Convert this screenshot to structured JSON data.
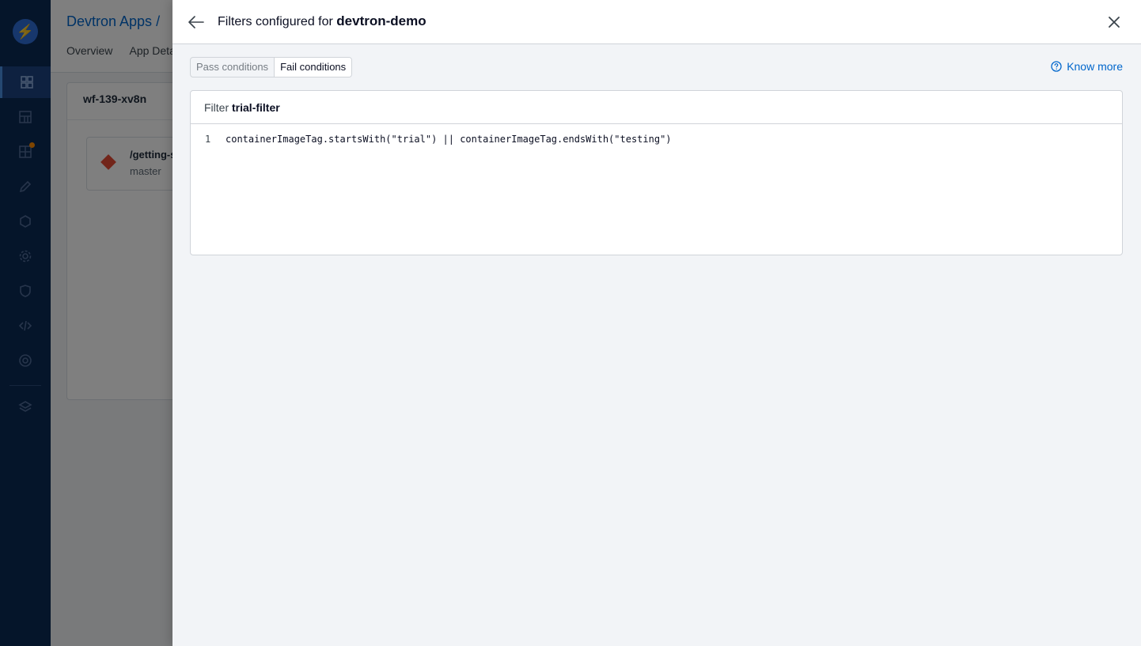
{
  "background": {
    "breadcrumb_title": "Devtron Apps /",
    "tabs": [
      "Overview",
      "App Details"
    ],
    "workflow_name": "wf-139-xv8n",
    "node_path": "/getting-started",
    "node_branch": "master"
  },
  "drawer": {
    "title_prefix": "Filters configured for",
    "app_name": "devtron-demo",
    "tabs": [
      {
        "label": "Pass conditions",
        "selected": false
      },
      {
        "label": "Fail conditions",
        "selected": true
      }
    ],
    "know_more_label": "Know more",
    "filter": {
      "prefix": "Filter",
      "name": "trial-filter",
      "lines": [
        {
          "number": "1",
          "code": "containerImageTag.startsWith(\"trial\") || containerImageTag.endsWith(\"testing\")"
        }
      ]
    }
  },
  "icons": {
    "back": "arrow-left-icon",
    "close": "close-icon",
    "help": "help-circle-icon"
  },
  "colors": {
    "accent": "#0066cc",
    "nav_bg": "#0b2a55",
    "overlay": "rgba(0,0,0,0.5)"
  }
}
